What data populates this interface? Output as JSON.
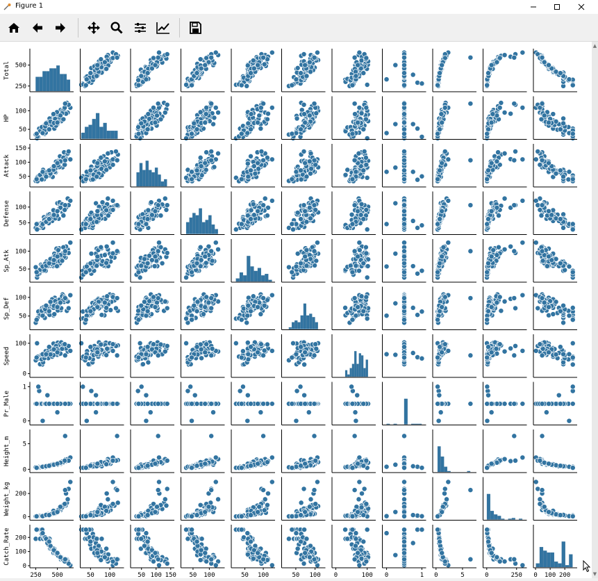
{
  "window": {
    "title": "Figure 1"
  },
  "toolbar": {
    "buttons": [
      "home-icon",
      "back-arrow-icon",
      "forward-arrow-icon",
      "pan-icon",
      "zoom-icon",
      "configure-subplots-icon",
      "edit-axis-icon",
      "save-icon"
    ]
  },
  "chart_data": {
    "type": "scatter",
    "plot_kind": "pairplot",
    "diagonal_kind": "histogram",
    "color": "#3274a1",
    "variables": [
      "Total",
      "HP",
      "Attack",
      "Defense",
      "Sp_Atk",
      "Sp_Def",
      "Speed",
      "Pr_Male",
      "Height_m",
      "Weight_kg",
      "Catch_Rate"
    ],
    "axis_labels": [
      "Total",
      "HP",
      "Attack",
      "Defense",
      "Sp_Atk",
      "Sp_Def",
      "Speed",
      "Pr_Male",
      "Height_m",
      "Weight_kg",
      "Catch_Rate"
    ],
    "ranges": {
      "Total": [
        190,
        680
      ],
      "HP": [
        25,
        135
      ],
      "Attack": [
        15,
        160
      ],
      "Defense": [
        15,
        145
      ],
      "Sp_Atk": [
        15,
        130
      ],
      "Sp_Def": [
        15,
        125
      ],
      "Speed": [
        -10,
        125
      ],
      "Pr_Male": [
        -0.1,
        1.1
      ],
      "Height_m": [
        -0.5,
        7.5
      ],
      "Weight_kg": [
        -25,
        330
      ],
      "Catch_Rate": [
        -10,
        280
      ]
    },
    "ticks": {
      "Total": [
        250,
        500
      ],
      "HP": [
        50,
        100
      ],
      "Attack": [
        50,
        100,
        150
      ],
      "Defense": [
        50,
        100
      ],
      "Sp_Atk": [
        50,
        100
      ],
      "Sp_Def": [
        50,
        100
      ],
      "Speed": [
        0,
        100
      ],
      "Pr_Male": [
        0,
        1
      ],
      "Height_m": [
        0,
        5
      ],
      "Weight_kg": [
        0,
        200
      ],
      "Catch_Rate": [
        0,
        100,
        200
      ]
    },
    "x_ticks": {
      "Total": [
        250,
        500
      ],
      "HP": [
        50,
        100
      ],
      "Attack": [
        50,
        100,
        150
      ],
      "Defense": [
        50,
        100
      ],
      "Sp_Atk": [
        50,
        100
      ],
      "Sp_Def": [
        50,
        100
      ],
      "Speed": [
        0,
        100
      ],
      "Pr_Male": [
        0,
        1
      ],
      "Height_m": [
        0,
        5
      ],
      "Weight_kg": [
        0,
        250
      ],
      "Catch_Rate": [
        0,
        100,
        200
      ]
    },
    "n_points": 60,
    "records": [
      [
        310,
        43,
        45,
        48,
        62,
        66,
        60,
        0.5,
        0.4,
        6.6,
        190
      ],
      [
        415,
        60,
        74,
        58,
        59,
        88,
        84,
        0.5,
        0.7,
        14,
        120
      ],
      [
        540,
        102,
        104,
        99,
        71,
        66,
        83,
        0.5,
        1.1,
        57,
        45
      ],
      [
        290,
        52,
        38,
        34,
        37,
        53,
        54,
        0.875,
        0.5,
        8.5,
        255
      ],
      [
        595,
        112,
        113,
        103,
        82,
        92,
        96,
        0.5,
        1.9,
        95,
        45
      ],
      [
        355,
        38,
        45,
        58,
        52,
        45,
        58,
        0.5,
        0.4,
        7.4,
        190
      ],
      [
        280,
        30,
        50,
        42,
        45,
        62,
        50,
        1,
        0.3,
        3.5,
        255
      ],
      [
        480,
        70,
        64,
        77,
        85,
        97,
        86,
        0.5,
        1,
        32,
        90
      ],
      [
        250,
        36,
        34,
        34,
        55,
        32,
        44,
        0.5,
        0.4,
        2.1,
        190
      ],
      [
        375,
        69,
        48,
        54,
        71,
        74,
        59,
        0.5,
        0.6,
        12,
        190
      ],
      [
        455,
        86,
        79,
        81,
        58,
        52,
        99,
        0.5,
        1.1,
        45,
        90
      ],
      [
        500,
        64,
        81,
        112,
        93,
        84,
        62,
        0.25,
        0.9,
        40,
        75
      ],
      [
        325,
        47,
        53,
        37,
        45,
        72,
        30,
        0.5,
        0.5,
        10,
        255
      ],
      [
        505,
        90,
        104,
        89,
        58,
        65,
        102,
        0.5,
        1.2,
        58,
        75
      ],
      [
        610,
        121,
        127,
        104,
        98,
        64,
        93,
        0.5,
        1.8,
        120,
        45
      ],
      [
        430,
        55,
        69,
        68,
        71,
        85,
        64,
        0.5,
        0.8,
        20,
        120
      ],
      [
        470,
        84,
        66,
        86,
        60,
        99,
        74,
        0.5,
        1,
        24,
        90
      ],
      [
        380,
        68,
        50,
        52,
        63,
        76,
        74,
        0.5,
        0.6,
        14,
        190
      ],
      [
        520,
        78,
        96,
        95,
        108,
        75,
        74,
        0.5,
        1.3,
        70,
        60
      ],
      [
        560,
        100,
        82,
        83,
        93,
        108,
        100,
        0.5,
        1.4,
        90,
        45
      ],
      [
        265,
        26,
        45,
        29,
        26,
        43,
        100,
        0.5,
        0.3,
        1.5,
        255
      ],
      [
        345,
        59,
        40,
        68,
        45,
        74,
        62,
        0.5,
        0.5,
        8,
        190
      ],
      [
        395,
        49,
        69,
        76,
        61,
        58,
        51,
        0.5,
        0.7,
        22,
        150
      ],
      [
        445,
        74,
        48,
        74,
        81,
        72,
        84,
        0.5,
        0.9,
        25,
        120
      ],
      [
        490,
        66,
        94,
        71,
        107,
        92,
        73,
        0.5,
        1.1,
        33,
        90
      ],
      [
        530,
        84,
        121,
        108,
        66,
        88,
        64,
        0.5,
        1.2,
        66,
        60
      ],
      [
        578,
        104,
        135,
        91,
        84,
        88,
        82,
        0.5,
        1.6,
        95,
        45
      ],
      [
        620,
        95,
        131,
        127,
        105,
        89,
        73,
        0.5,
        2,
        150,
        30
      ],
      [
        300,
        45,
        55,
        43,
        48,
        52,
        31,
        0.5,
        0.4,
        6,
        190
      ],
      [
        410,
        79,
        54,
        77,
        63,
        53,
        70,
        0.5,
        0.6,
        16,
        190
      ],
      [
        465,
        52,
        84,
        82,
        93,
        55,
        84,
        0.5,
        0.9,
        28,
        120
      ],
      [
        515,
        88,
        89,
        63,
        91,
        82,
        94,
        0.5,
        1.1,
        52,
        75
      ],
      [
        545,
        72,
        105,
        101,
        77,
        71,
        103,
        0.5,
        1.3,
        70,
        60
      ],
      [
        335,
        55,
        73,
        34,
        56,
        58,
        37,
        0.5,
        0.5,
        9,
        190
      ],
      [
        365,
        41,
        53,
        63,
        45,
        64,
        74,
        0.5,
        0.6,
        11,
        190
      ],
      [
        425,
        62,
        75,
        72,
        64,
        78,
        69,
        0.5,
        0.8,
        18,
        120
      ],
      [
        440,
        70,
        69,
        56,
        77,
        95,
        56,
        0.5,
        0.8,
        21,
        120
      ],
      [
        485,
        60,
        102,
        73,
        71,
        77,
        91,
        0.5,
        1,
        35,
        90
      ],
      [
        525,
        81,
        83,
        115,
        72,
        94,
        77,
        0.5,
        1.3,
        75,
        60
      ],
      [
        600,
        92,
        111,
        98,
        113,
        96,
        83,
        0.5,
        1.6,
        200,
        45
      ],
      [
        650,
        108,
        110,
        120,
        124,
        106,
        75,
        0.5,
        2.3,
        300,
        3
      ],
      [
        630,
        116,
        138,
        106,
        95,
        71,
        91,
        0.5,
        1.7,
        240,
        15
      ],
      [
        270,
        31,
        33,
        47,
        34,
        44,
        56,
        0.5,
        0.3,
        3,
        255
      ],
      [
        320,
        56,
        39,
        41,
        59,
        64,
        47,
        0.5,
        0.5,
        5,
        225
      ],
      [
        350,
        47,
        63,
        59,
        47,
        70,
        51,
        0.5,
        0.6,
        9,
        200
      ],
      [
        400,
        55,
        59,
        49,
        70,
        73,
        78,
        0.5,
        0.7,
        15,
        180
      ],
      [
        435,
        62,
        72,
        69,
        64,
        82,
        81,
        0.5,
        0.9,
        25,
        130
      ],
      [
        475,
        78,
        77,
        64,
        87,
        90,
        78,
        0.5,
        1,
        30,
        100
      ],
      [
        495,
        96,
        95,
        73,
        58,
        81,
        82,
        0.5,
        1.1,
        45,
        80
      ],
      [
        510,
        70,
        89,
        89,
        103,
        78,
        76,
        0.5,
        1.2,
        55,
        70
      ],
      [
        555,
        93,
        101,
        109,
        73,
        103,
        82,
        0.5,
        1.5,
        80,
        50
      ],
      [
        570,
        77,
        116,
        73,
        111,
        93,
        96,
        0.5,
        1.4,
        100,
        40
      ],
      [
        585,
        108,
        91,
        91,
        94,
        101,
        97,
        0.5,
        1.7,
        110,
        30
      ],
      [
        535,
        87,
        103,
        98,
        89,
        86,
        66,
        0.5,
        1.3,
        85,
        60
      ],
      [
        455,
        91,
        73,
        90,
        67,
        72,
        61,
        0.5,
        1,
        50,
        120
      ],
      [
        385,
        64,
        66,
        56,
        58,
        72,
        68,
        0.75,
        0.6,
        13,
        160
      ],
      [
        360,
        58,
        56,
        52,
        65,
        68,
        61,
        0.5,
        0.6,
        10,
        200
      ],
      [
        420,
        71,
        60,
        64,
        78,
        88,
        63,
        0.5,
        0.8,
        20,
        140
      ],
      [
        460,
        67,
        86,
        75,
        75,
        77,
        80,
        0.5,
        0.9,
        30,
        110
      ],
      [
        330,
        40,
        66,
        46,
        57,
        51,
        64,
        0,
        0.5,
        4,
        230
      ],
      [
        370,
        66,
        49,
        53,
        59,
        78,
        64,
        0.5,
        0.6,
        15,
        190
      ],
      [
        405,
        50,
        71,
        62,
        66,
        63,
        88,
        0.5,
        0.7,
        13,
        170
      ],
      [
        500,
        68,
        97,
        87,
        85,
        74,
        70,
        0.5,
        1.1,
        40,
        90
      ],
      [
        590,
        119,
        107,
        106,
        100,
        98,
        60,
        0.5,
        6.5,
        230,
        45
      ],
      [
        260,
        38,
        40,
        46,
        41,
        40,
        53,
        0.5,
        0.3,
        2.5,
        255
      ]
    ]
  }
}
